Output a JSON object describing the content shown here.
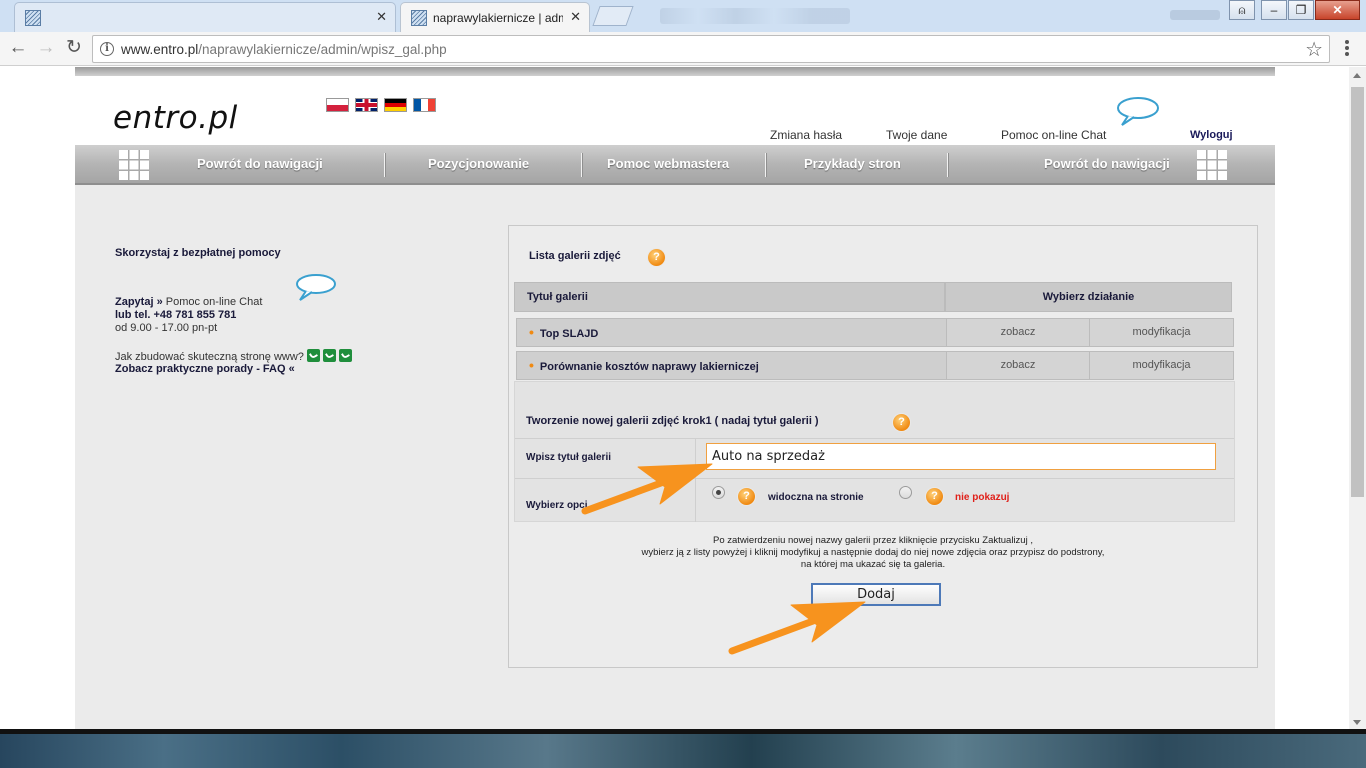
{
  "browser": {
    "tabs": [
      {
        "label": "",
        "active": false
      },
      {
        "label": "naprawylakiernicze | adm",
        "active": true
      }
    ],
    "url_host": "www.entro.pl",
    "url_path": "/naprawylakiernicze/admin/wpisz_gal.php"
  },
  "site": {
    "logo": "entro.pl",
    "top_links": {
      "change_password": "Zmiana hasła",
      "your_data": "Twoje dane",
      "online_help": "Pomoc on-line Chat",
      "logout": "Wyloguj"
    },
    "nav": [
      "Powrót do nawigacji",
      "Pozycjonowanie",
      "Pomoc webmastera",
      "Przykłady stron",
      "Powrót do nawigacji"
    ],
    "sidebar": {
      "title": "Skorzystaj z bezpłatnej pomocy",
      "ask_bold": "Zapytaj",
      "ask_arrow": "»",
      "ask_link": "Pomoc on-line Chat",
      "phone": "lub tel. +48 781 855 781",
      "hours": "od 9.00 - 17.00 pn-pt",
      "faq_question": "Jak zbudować skuteczną stronę www?",
      "faq_link": "Zobacz praktyczne porady - FAQ «"
    },
    "gallery_list": {
      "title": "Lista galerii zdjęć",
      "col_title": "Tytuł galerii",
      "col_action": "Wybierz działanie",
      "rows": [
        {
          "name": "Top SLAJD",
          "view": "zobacz",
          "modify": "modyfikacja"
        },
        {
          "name": "Porównanie kosztów naprawy lakierniczej",
          "view": "zobacz",
          "modify": "modyfikacja"
        }
      ]
    },
    "new_gallery": {
      "title": "Tworzenie nowej galerii zdjęć krok1 ( nadaj tytuł galerii )",
      "title_label": "Wpisz tytuł galerii",
      "title_value": "Auto na sprzedaż",
      "options_label": "Wybierz opcj",
      "option_visible": "widoczna na stronie",
      "option_hidden": "nie pokazuj",
      "info_line1": "Po zatwierdzeniu nowej nazwy galerii przez kliknięcie przycisku Zaktualizuj ,",
      "info_line2": "wybierz ją z listy powyżej i kliknij modyfikuj a następnie dodaj do niej nowe zdjęcia oraz przypisz do podstrony,",
      "info_line3": "na której ma ukazać się ta galeria.",
      "submit": "Dodaj"
    },
    "colors": {
      "accent_orange": "#f08a12",
      "link_navy": "#1a1a3a",
      "hidden_red": "#e0201a",
      "button_border": "#4d79b8"
    }
  }
}
